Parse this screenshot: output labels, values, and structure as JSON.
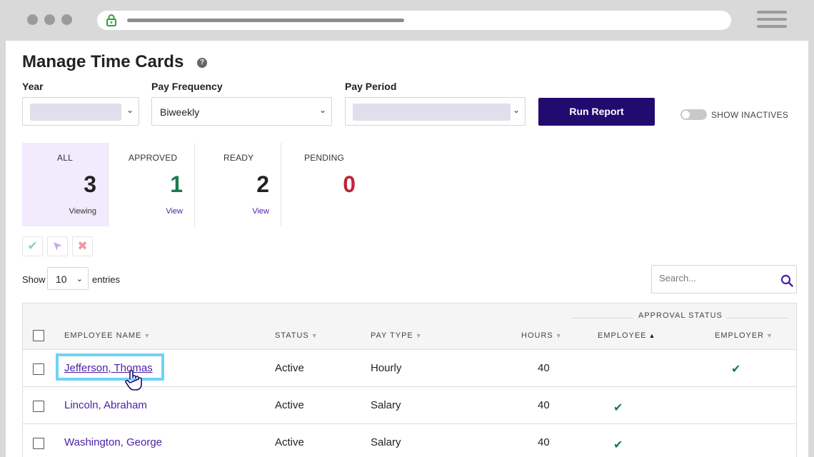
{
  "page": {
    "title": "Manage Time Cards",
    "help_icon": "?"
  },
  "filters": {
    "year_label": "Year",
    "pay_frequency_label": "Pay Frequency",
    "pay_frequency_value": "Biweekly",
    "pay_period_label": "Pay Period",
    "run_report_label": "Run Report",
    "show_inactives_label": "SHOW INACTIVES"
  },
  "summary": [
    {
      "label": "ALL",
      "count": "3",
      "sub": "Viewing",
      "color": "#222222"
    },
    {
      "label": "APPROVED",
      "count": "1",
      "sub": "View",
      "color": "#1a7a50"
    },
    {
      "label": "READY",
      "count": "2",
      "sub": "View",
      "color": "#222222"
    },
    {
      "label": "PENDING",
      "count": "0",
      "sub": "",
      "color": "#c0253a"
    }
  ],
  "bulk_actions": [
    {
      "icon": "check-icon",
      "color": "#8fd0b0"
    },
    {
      "icon": "send-icon",
      "color": "#c7a6f2"
    },
    {
      "icon": "x-icon",
      "color": "#e69aa2"
    }
  ],
  "list_controls": {
    "show_label": "Show",
    "entries_value": "10",
    "entries_label": "entries",
    "search_placeholder": "Search..."
  },
  "table": {
    "group_header": "APPROVAL STATUS",
    "columns": [
      "EMPLOYEE NAME",
      "STATUS",
      "PAY TYPE",
      "HOURS",
      "EMPLOYEE",
      "EMPLOYER"
    ],
    "rows": [
      {
        "name": "Jefferson, Thomas",
        "status": "Active",
        "pay_type": "Hourly",
        "hours": "40",
        "employee_approved": false,
        "employer_approved": true
      },
      {
        "name": "Lincoln, Abraham",
        "status": "Active",
        "pay_type": "Salary",
        "hours": "40",
        "employee_approved": true,
        "employer_approved": false
      },
      {
        "name": "Washington, George",
        "status": "Active",
        "pay_type": "Salary",
        "hours": "40",
        "employee_approved": true,
        "employer_approved": false
      }
    ]
  },
  "colors": {
    "accent": "#230a6f",
    "link": "#4b1fa5",
    "highlight": "#6fd3f6"
  }
}
